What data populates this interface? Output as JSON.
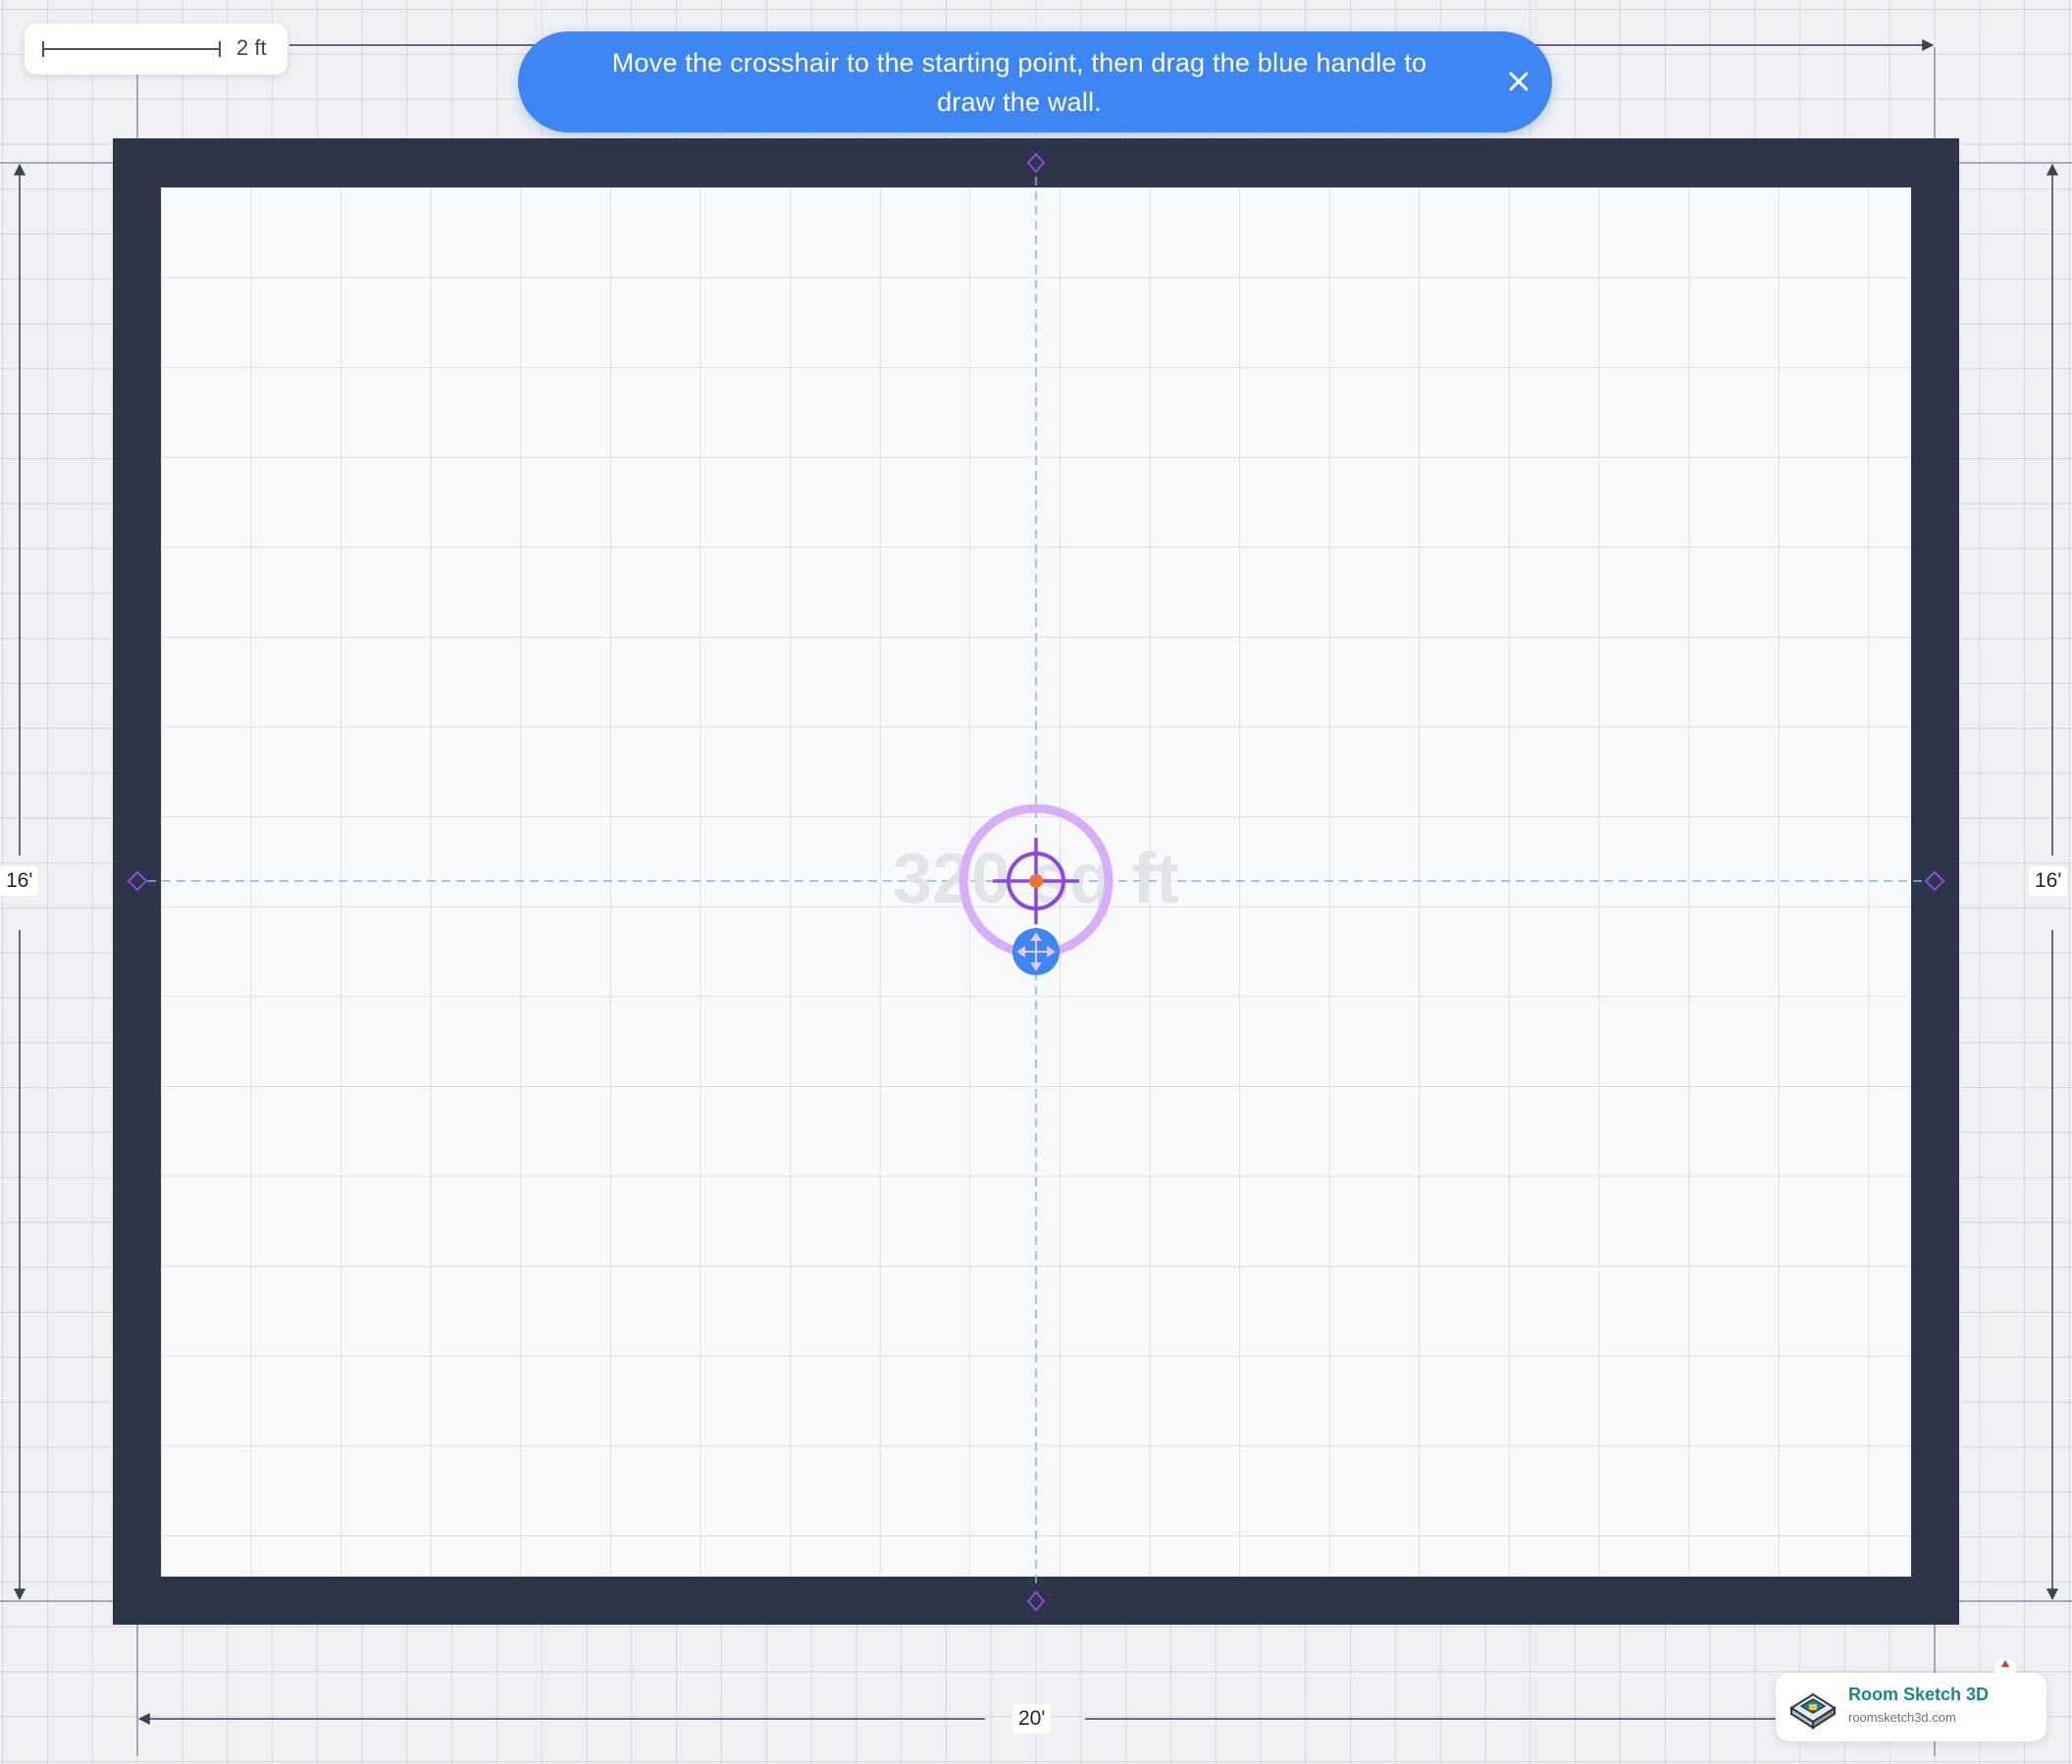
{
  "scale": {
    "label": "2 ft"
  },
  "banner": {
    "line1": "Move the crosshair to the starting point, then drag the blue handle to",
    "line2": "draw the wall.",
    "close_icon": "close-icon"
  },
  "room": {
    "area_label": "320 sq ft",
    "width_label": "20'",
    "height_label_left": "16'",
    "height_label_right": "16'",
    "wall_color": "#2d3648",
    "floor_color": "#f8f9fb"
  },
  "tool": {
    "crosshair_icon": "crosshair-icon",
    "handle_icon": "move-arrows-icon",
    "ring_color": "#d9aef8",
    "crosshair_color": "#8b48e0",
    "handle_color": "#3d86f4",
    "center_color": "#f0752b"
  },
  "brand": {
    "name": "Room Sketch 3D",
    "url": "roomsketch3d.com",
    "logo_icon": "house-logo-icon",
    "accent_color": "#1a8a80"
  }
}
